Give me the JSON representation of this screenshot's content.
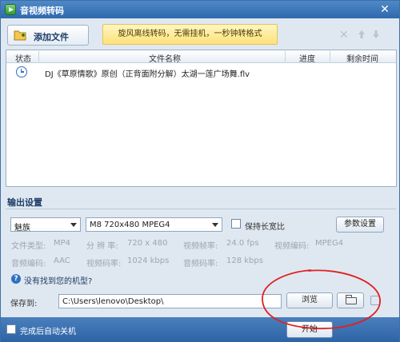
{
  "window": {
    "title": "音视频转码",
    "close_glyph": "✕"
  },
  "toolbar": {
    "add_file_label": "添加文件",
    "promo_text": "旋风离线转码，无需挂机，一秒钟转格式",
    "delete_glyph": "✕"
  },
  "file_list": {
    "columns": [
      "状态",
      "文件名称",
      "进度",
      "剩余时间"
    ],
    "rows": [
      {
        "status_icon": "clock-icon",
        "name": "DJ《草原情歌》原创（正背面附分解）太湖一莲广场舞.flv",
        "progress": "",
        "remaining": ""
      }
    ]
  },
  "output": {
    "section_title": "输出设置",
    "device_select": "魅族",
    "format_select": "M8 720x480 MPEG4",
    "keep_ratio_label": "保持长宽比",
    "params_button": "参数设置",
    "info": {
      "file_type_label": "文件类型:",
      "file_type_value": "MP4",
      "resolution_label": "分 辨 率:",
      "resolution_value": "720 x 480",
      "frame_rate_label": "视频帧率:",
      "frame_rate_value": "24.0 fps",
      "video_codec_label": "视频编码:",
      "video_codec_value": "MPEG4",
      "audio_codec_label": "音频编码:",
      "audio_codec_value": "AAC",
      "video_bitrate_label": "视频码率:",
      "video_bitrate_value": "1024 kbps",
      "audio_bitrate_label": "音频码率:",
      "audio_bitrate_value": "128 kbps"
    },
    "help_glyph": "?",
    "help_link": "没有找到您的机型?",
    "save_to_label": "保存到:",
    "save_path": "C:\\Users\\lenovo\\Desktop\\",
    "browse_button": "浏览"
  },
  "footer": {
    "shutdown_label": "完成后自动关机",
    "start_button": "开始"
  },
  "colors": {
    "titlebar": "#2f69ae",
    "annotation": "#e02020",
    "promo_bg": "#ffe17a"
  }
}
